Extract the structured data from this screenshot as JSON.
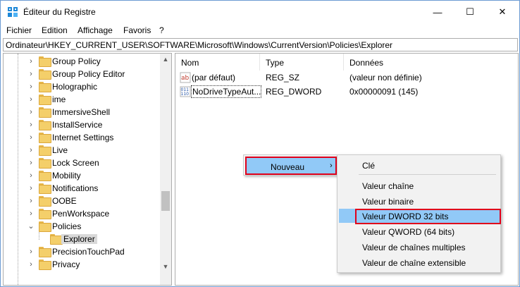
{
  "window": {
    "title": "Éditeur du Registre",
    "minimize_glyph": "—",
    "maximize_glyph": "☐",
    "close_glyph": "✕"
  },
  "menu": [
    "Fichier",
    "Edition",
    "Affichage",
    "Favoris",
    "?"
  ],
  "address": "Ordinateur\\HKEY_CURRENT_USER\\SOFTWARE\\Microsoft\\Windows\\CurrentVersion\\Policies\\Explorer",
  "tree": {
    "items": [
      {
        "label": "Group Policy",
        "expander": "›"
      },
      {
        "label": "Group Policy Editor",
        "expander": "›"
      },
      {
        "label": "Holographic",
        "expander": "›"
      },
      {
        "label": "ime",
        "expander": "›"
      },
      {
        "label": "ImmersiveShell",
        "expander": "›"
      },
      {
        "label": "InstallService",
        "expander": "›"
      },
      {
        "label": "Internet Settings",
        "expander": "›"
      },
      {
        "label": "Live",
        "expander": "›"
      },
      {
        "label": "Lock Screen",
        "expander": "›"
      },
      {
        "label": "Mobility",
        "expander": "›"
      },
      {
        "label": "Notifications",
        "expander": "›"
      },
      {
        "label": "OOBE",
        "expander": "›"
      },
      {
        "label": "PenWorkspace",
        "expander": "›"
      },
      {
        "label": "Policies",
        "expander": "⌄"
      },
      {
        "label": "Explorer",
        "expander": "",
        "selected": true
      },
      {
        "label": "PrecisionTouchPad",
        "expander": "›"
      },
      {
        "label": "Privacy",
        "expander": "›"
      }
    ]
  },
  "values_pane": {
    "headers": {
      "name": "Nom",
      "type": "Type",
      "data": "Données"
    },
    "rows": [
      {
        "name": "(par défaut)",
        "type": "REG_SZ",
        "data": "(valeur non définie)",
        "icon": "string-value-icon",
        "icon_text": "ab"
      },
      {
        "name": "NoDriveTypeAut...",
        "type": "REG_DWORD",
        "data": "0x00000091 (145)",
        "icon": "binary-value-icon",
        "icon_text": "011"
      }
    ]
  },
  "context_menu": {
    "new_label": "Nouveau",
    "new_arrow": "›"
  },
  "submenu": {
    "items": [
      "Clé",
      "Valeur chaîne",
      "Valeur binaire",
      "Valeur DWORD 32 bits",
      "Valeur QWORD (64 bits)",
      "Valeur de chaînes multiples",
      "Valeur de chaîne extensible"
    ],
    "highlighted_index": 3
  },
  "colors": {
    "highlight": "#91c9f7",
    "annotation_red": "#e0001b",
    "folder": "#f4cf6a"
  }
}
